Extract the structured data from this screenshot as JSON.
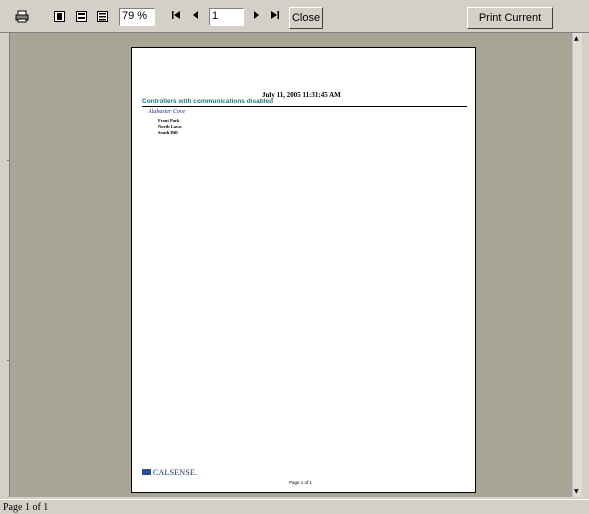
{
  "toolbar": {
    "icons": [
      "printer-icon",
      "single-page-icon",
      "two-page-icon",
      "multi-page-icon"
    ],
    "zoom_value": "79 %",
    "nav": {
      "first": "⏮",
      "prev": "◀",
      "next": "▶",
      "last": "⏭"
    },
    "page_value": "1",
    "close_label": "Close",
    "print_label": "Print Current Page"
  },
  "report": {
    "date": "July 11, 2005 11:31:45 AM",
    "title": "Controllers with communications disabled",
    "group": "Alabaster Cove",
    "rows": [
      "Front Park",
      "North Lawn",
      "South Hill"
    ],
    "logo_text": "CALSENSE.",
    "footer": "Page 1 of 1"
  },
  "status": {
    "text": "Page 1 of 1"
  },
  "colors": {
    "title": "#1e7878",
    "group": "#1a2c8a",
    "preview_bg": "#a8a496",
    "chrome": "#d4d0c8"
  }
}
